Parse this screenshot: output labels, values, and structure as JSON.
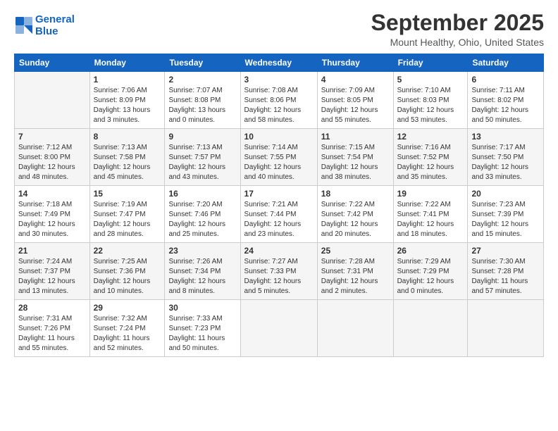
{
  "header": {
    "logo_line1": "General",
    "logo_line2": "Blue",
    "month": "September 2025",
    "location": "Mount Healthy, Ohio, United States"
  },
  "weekdays": [
    "Sunday",
    "Monday",
    "Tuesday",
    "Wednesday",
    "Thursday",
    "Friday",
    "Saturday"
  ],
  "weeks": [
    [
      {
        "day": "",
        "info": ""
      },
      {
        "day": "1",
        "info": "Sunrise: 7:06 AM\nSunset: 8:09 PM\nDaylight: 13 hours\nand 3 minutes."
      },
      {
        "day": "2",
        "info": "Sunrise: 7:07 AM\nSunset: 8:08 PM\nDaylight: 13 hours\nand 0 minutes."
      },
      {
        "day": "3",
        "info": "Sunrise: 7:08 AM\nSunset: 8:06 PM\nDaylight: 12 hours\nand 58 minutes."
      },
      {
        "day": "4",
        "info": "Sunrise: 7:09 AM\nSunset: 8:05 PM\nDaylight: 12 hours\nand 55 minutes."
      },
      {
        "day": "5",
        "info": "Sunrise: 7:10 AM\nSunset: 8:03 PM\nDaylight: 12 hours\nand 53 minutes."
      },
      {
        "day": "6",
        "info": "Sunrise: 7:11 AM\nSunset: 8:02 PM\nDaylight: 12 hours\nand 50 minutes."
      }
    ],
    [
      {
        "day": "7",
        "info": "Sunrise: 7:12 AM\nSunset: 8:00 PM\nDaylight: 12 hours\nand 48 minutes."
      },
      {
        "day": "8",
        "info": "Sunrise: 7:13 AM\nSunset: 7:58 PM\nDaylight: 12 hours\nand 45 minutes."
      },
      {
        "day": "9",
        "info": "Sunrise: 7:13 AM\nSunset: 7:57 PM\nDaylight: 12 hours\nand 43 minutes."
      },
      {
        "day": "10",
        "info": "Sunrise: 7:14 AM\nSunset: 7:55 PM\nDaylight: 12 hours\nand 40 minutes."
      },
      {
        "day": "11",
        "info": "Sunrise: 7:15 AM\nSunset: 7:54 PM\nDaylight: 12 hours\nand 38 minutes."
      },
      {
        "day": "12",
        "info": "Sunrise: 7:16 AM\nSunset: 7:52 PM\nDaylight: 12 hours\nand 35 minutes."
      },
      {
        "day": "13",
        "info": "Sunrise: 7:17 AM\nSunset: 7:50 PM\nDaylight: 12 hours\nand 33 minutes."
      }
    ],
    [
      {
        "day": "14",
        "info": "Sunrise: 7:18 AM\nSunset: 7:49 PM\nDaylight: 12 hours\nand 30 minutes."
      },
      {
        "day": "15",
        "info": "Sunrise: 7:19 AM\nSunset: 7:47 PM\nDaylight: 12 hours\nand 28 minutes."
      },
      {
        "day": "16",
        "info": "Sunrise: 7:20 AM\nSunset: 7:46 PM\nDaylight: 12 hours\nand 25 minutes."
      },
      {
        "day": "17",
        "info": "Sunrise: 7:21 AM\nSunset: 7:44 PM\nDaylight: 12 hours\nand 23 minutes."
      },
      {
        "day": "18",
        "info": "Sunrise: 7:22 AM\nSunset: 7:42 PM\nDaylight: 12 hours\nand 20 minutes."
      },
      {
        "day": "19",
        "info": "Sunrise: 7:22 AM\nSunset: 7:41 PM\nDaylight: 12 hours\nand 18 minutes."
      },
      {
        "day": "20",
        "info": "Sunrise: 7:23 AM\nSunset: 7:39 PM\nDaylight: 12 hours\nand 15 minutes."
      }
    ],
    [
      {
        "day": "21",
        "info": "Sunrise: 7:24 AM\nSunset: 7:37 PM\nDaylight: 12 hours\nand 13 minutes."
      },
      {
        "day": "22",
        "info": "Sunrise: 7:25 AM\nSunset: 7:36 PM\nDaylight: 12 hours\nand 10 minutes."
      },
      {
        "day": "23",
        "info": "Sunrise: 7:26 AM\nSunset: 7:34 PM\nDaylight: 12 hours\nand 8 minutes."
      },
      {
        "day": "24",
        "info": "Sunrise: 7:27 AM\nSunset: 7:33 PM\nDaylight: 12 hours\nand 5 minutes."
      },
      {
        "day": "25",
        "info": "Sunrise: 7:28 AM\nSunset: 7:31 PM\nDaylight: 12 hours\nand 2 minutes."
      },
      {
        "day": "26",
        "info": "Sunrise: 7:29 AM\nSunset: 7:29 PM\nDaylight: 12 hours\nand 0 minutes."
      },
      {
        "day": "27",
        "info": "Sunrise: 7:30 AM\nSunset: 7:28 PM\nDaylight: 11 hours\nand 57 minutes."
      }
    ],
    [
      {
        "day": "28",
        "info": "Sunrise: 7:31 AM\nSunset: 7:26 PM\nDaylight: 11 hours\nand 55 minutes."
      },
      {
        "day": "29",
        "info": "Sunrise: 7:32 AM\nSunset: 7:24 PM\nDaylight: 11 hours\nand 52 minutes."
      },
      {
        "day": "30",
        "info": "Sunrise: 7:33 AM\nSunset: 7:23 PM\nDaylight: 11 hours\nand 50 minutes."
      },
      {
        "day": "",
        "info": ""
      },
      {
        "day": "",
        "info": ""
      },
      {
        "day": "",
        "info": ""
      },
      {
        "day": "",
        "info": ""
      }
    ]
  ]
}
